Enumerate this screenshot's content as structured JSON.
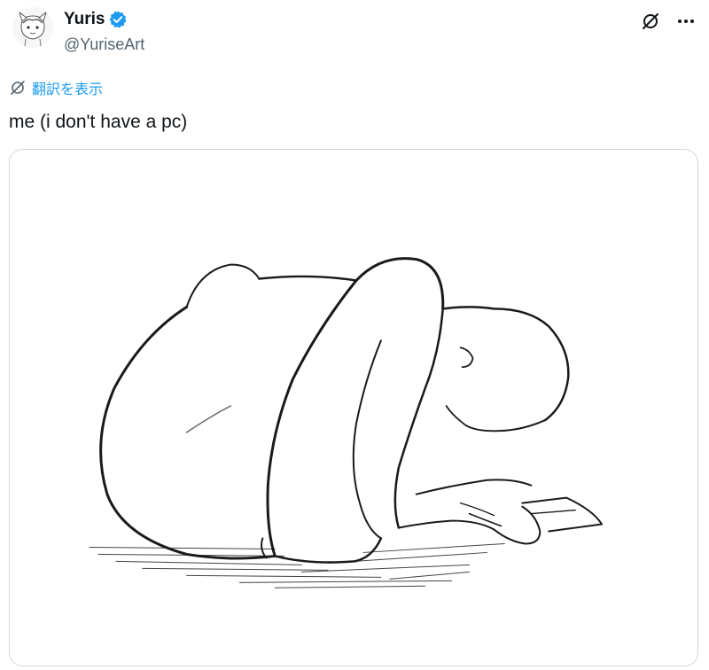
{
  "post": {
    "author": {
      "display_name": "Yuris",
      "handle": "@YuriseArt",
      "verified": true,
      "verified_color": "#1d9bf0"
    },
    "translate_label": "翻訳を表示",
    "text": "me (i don't have a pc)",
    "icons": {
      "grok": "grok-icon",
      "more": "more-icon",
      "translate": "translate-icon"
    },
    "media": {
      "kind": "sketch-illustration"
    }
  }
}
